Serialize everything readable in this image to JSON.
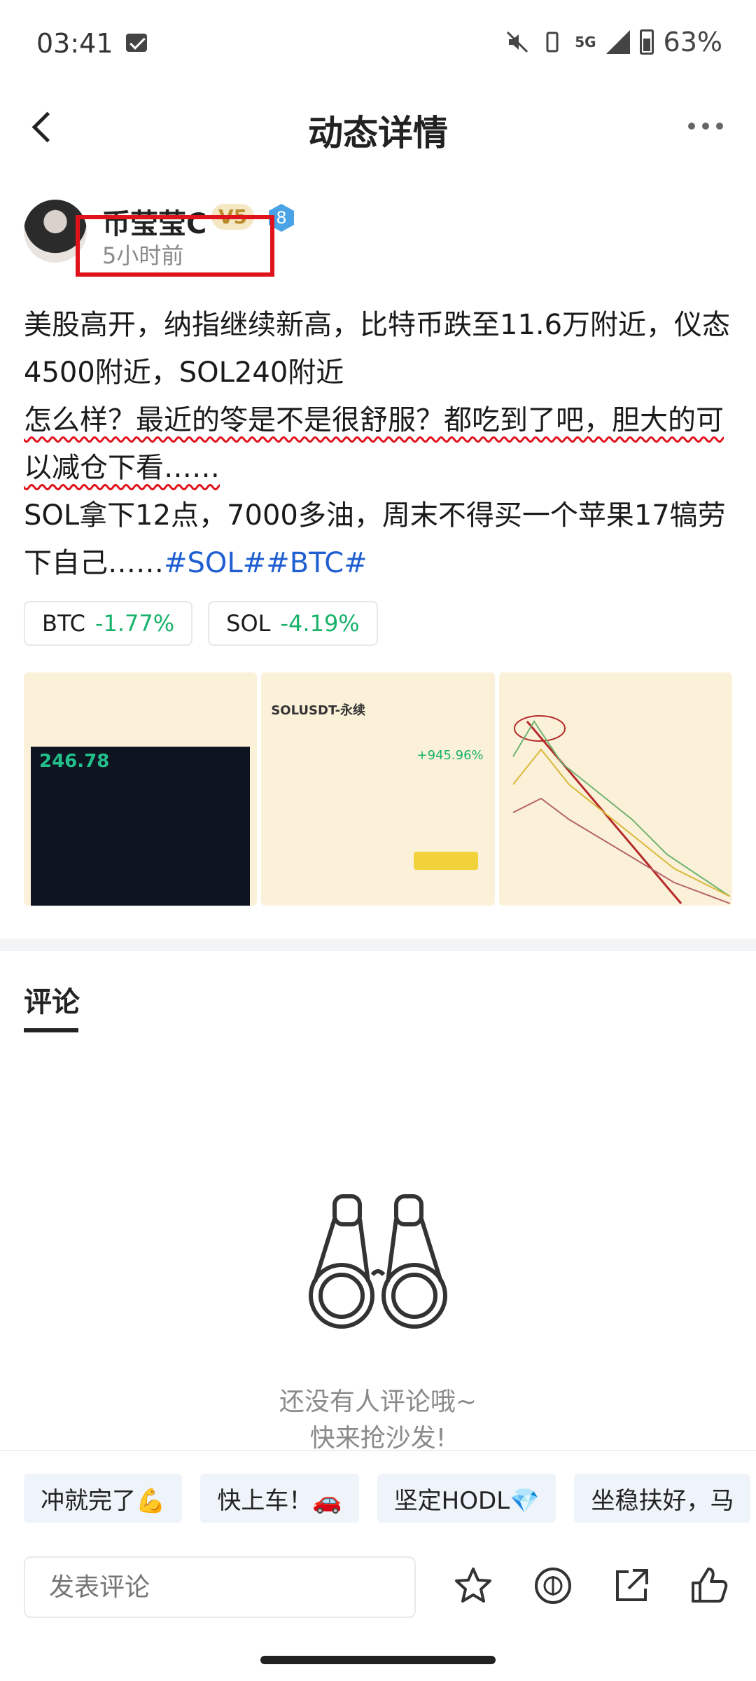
{
  "status_bar": {
    "time": "03:41",
    "network": "5G",
    "battery": "63%"
  },
  "header": {
    "title": "动态详情"
  },
  "author": {
    "name": "币莹莹C",
    "vip_level": "V5",
    "level": "8",
    "time_ago": "5小时前"
  },
  "post": {
    "line1": "美股高开，纳指继续新高，比特币跌至11.6万附近，仪态4500附近，SOL240附近",
    "line2": "怎么样？最近的笭是不是很舒服？都吃到了吧，胆大的可以减仓下看……",
    "line3_text": "SOL拿下12点，7000多油，周末不得买一个苹果17犒劳下自己……",
    "tags": "#SOL##BTC#"
  },
  "tickers": [
    {
      "symbol": "BTC",
      "change": "-1.77%",
      "color": "#17b26a"
    },
    {
      "symbol": "SOL",
      "change": "-4.19%",
      "color": "#17b26a"
    }
  ],
  "images": {
    "img1_price": "246.78",
    "img2_title": "SOLUSDT-永续",
    "img2_pnl": "+945.96%"
  },
  "comments": {
    "tab_label": "评论",
    "empty_line1": "还没有人评论哦~",
    "empty_line2": "快来抢沙发!"
  },
  "quick_replies": [
    "冲就完了💪",
    "快上车！🚗",
    "坚定HODL💎",
    "坐稳扶好，马"
  ],
  "bottom_bar": {
    "input_placeholder": "发表评论"
  },
  "icons": {
    "star": "star-icon",
    "share": "share-icon",
    "like": "thumbs-up-icon",
    "tip": "tip-icon"
  }
}
